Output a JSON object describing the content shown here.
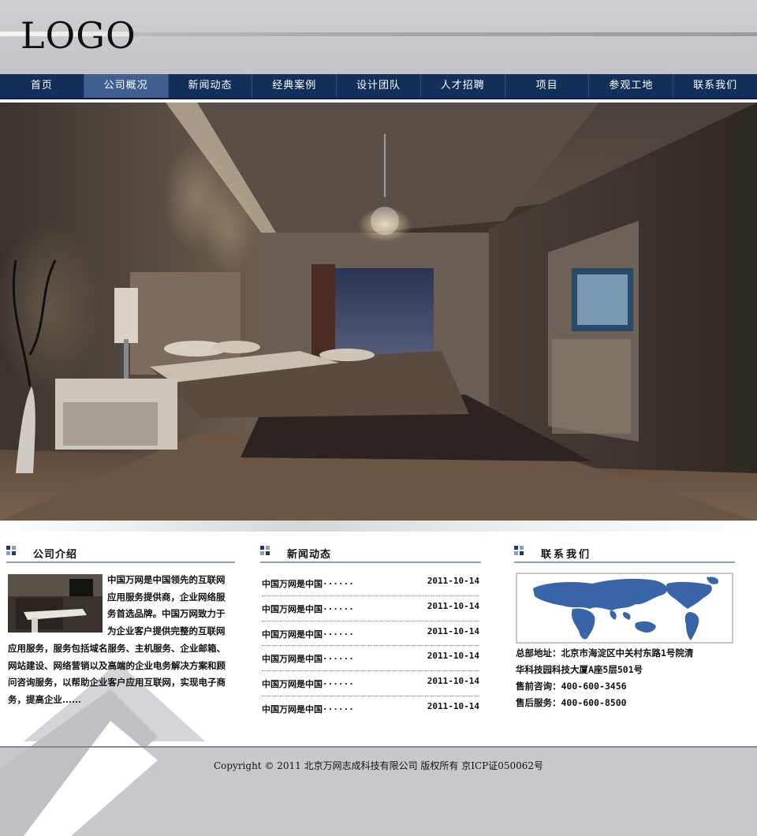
{
  "header": {
    "logo_text": "LOGO"
  },
  "nav": {
    "items": [
      {
        "label": "首页"
      },
      {
        "label": "公司概况"
      },
      {
        "label": "新闻动态"
      },
      {
        "label": "经典案例"
      },
      {
        "label": "设计团队"
      },
      {
        "label": "人才招聘"
      },
      {
        "label": "项目"
      },
      {
        "label": "参观工地"
      },
      {
        "label": "联系我们"
      }
    ],
    "active_index": 1,
    "colors": {
      "bar": "#12305a",
      "active": "#3e5f8f"
    }
  },
  "hero": {
    "description_icon": "bedroom-photo"
  },
  "about": {
    "title": "公司介绍",
    "text": "中国万网是中国领先的互联网应用服务提供商，企业网络服务首选品牌。中国万网致力于为企业客户提供完整的互联网应用服务，服务包括域名服务、主机服务、企业邮箱、网站建设、网络营销以及高端的企业电务解决方案和顾问咨询服务，以帮助企业客户应用互联网，实现电子商务，提高企业......"
  },
  "news": {
    "title": "新闻动态",
    "items": [
      {
        "title": "中国万网是中国······",
        "date": "2011-10-14"
      },
      {
        "title": "中国万网是中国······",
        "date": "2011-10-14"
      },
      {
        "title": "中国万网是中国······",
        "date": "2011-10-14"
      },
      {
        "title": "中国万网是中国······",
        "date": "2011-10-14"
      },
      {
        "title": "中国万网是中国······",
        "date": "2011-10-14"
      },
      {
        "title": "中国万网是中国······",
        "date": "2011-10-14"
      }
    ]
  },
  "contact": {
    "title": "联系我们",
    "map_icon": "world-map",
    "address_line1": "总部地址：北京市海淀区中关村东路1号院清",
    "address_line2": "华科技园科技大厦A座5层501号",
    "presale": "售前咨询：400-600-3456",
    "aftersale": "售后服务：400-600-8500"
  },
  "footer": {
    "copyright": "Copyright © 2011 北京万网志成科技有限公司 版权所有 京ICP证050062号"
  }
}
